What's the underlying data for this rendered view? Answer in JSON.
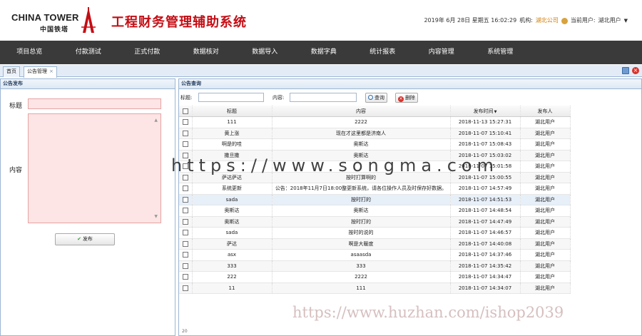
{
  "header": {
    "logo_en": "CHINA TOWER",
    "logo_cn": "中国铁塔",
    "app_title": "工程财务管理辅助系统",
    "datetime": "2019年 6月 28日 星期五 16:02:29",
    "org_label": "机构:",
    "org_value": "湖北公司",
    "user_label": "当前用户:",
    "user_value": "湖北用户",
    "brand_color": "#c40d14",
    "icons": [
      "china-tower-logo",
      "user-icon",
      "caret-down-icon"
    ]
  },
  "nav": {
    "items": [
      "项目总览",
      "付款测试",
      "正式付款",
      "数据核对",
      "数据导入",
      "数据字典",
      "统计报表",
      "内容管理",
      "系统管理"
    ]
  },
  "tabs": {
    "items": [
      {
        "label": "首页"
      },
      {
        "label": "公告管理"
      }
    ],
    "close_glyph": "×"
  },
  "left_panel": {
    "title": "公告发布",
    "title_label": "标题",
    "content_label": "内容",
    "publish_label": "发布"
  },
  "right_panel": {
    "title": "公告查询",
    "search": {
      "title_label": "标题:",
      "content_label": "内容:",
      "query_label": "查询",
      "delete_label": "删除"
    },
    "columns": [
      "标题",
      "内容",
      "发布时间",
      "发布人"
    ],
    "rows": [
      {
        "title": "111",
        "content": "2222",
        "time": "2018-11-13 15:27:31",
        "author": "湖北用户"
      },
      {
        "title": "黄上涨",
        "content": "现在才这里都是济南人",
        "time": "2018-11-07 15:10:41",
        "author": "湖北用户"
      },
      {
        "title": "啊是的哇",
        "content": "奥斯达",
        "time": "2018-11-07 15:08:43",
        "author": "湖北用户"
      },
      {
        "title": "撒旦撒",
        "content": "奥斯达",
        "time": "2018-11-07 15:03:02",
        "author": "湖北用户"
      },
      {
        "title": "",
        "content": "",
        "time": "2018-11-07 15:01:58",
        "author": "湖北用户"
      },
      {
        "title": "萨达萨达",
        "content": "按时打算啊的",
        "time": "2018-11-07 15:00:55",
        "author": "湖北用户"
      },
      {
        "title": "系统更新",
        "content": "公告：2018年11月7日18:00整更新系统，请各位操作人员及时保存好数据。",
        "time": "2018-11-07 14:57:49",
        "author": "湖北用户"
      },
      {
        "title": "sada",
        "content": "按时打的",
        "time": "2018-11-07 14:51:53",
        "author": "湖北用户"
      },
      {
        "title": "奥斯达",
        "content": "奥斯达",
        "time": "2018-11-07 14:48:54",
        "author": "湖北用户"
      },
      {
        "title": "奥斯达",
        "content": "按时打的",
        "time": "2018-11-07 14:47:49",
        "author": "湖北用户"
      },
      {
        "title": "sada",
        "content": "按时的说的",
        "time": "2018-11-07 14:46:57",
        "author": "湖北用户"
      },
      {
        "title": "萨达",
        "content": "啊是大暖度",
        "time": "2018-11-07 14:40:08",
        "author": "湖北用户"
      },
      {
        "title": "asx",
        "content": "asaasda",
        "time": "2018-11-07 14:37:46",
        "author": "湖北用户"
      },
      {
        "title": "333",
        "content": "333",
        "time": "2018-11-07 14:35:42",
        "author": "湖北用户"
      },
      {
        "title": "222",
        "content": "2222",
        "time": "2018-11-07 14:34:47",
        "author": "湖北用户"
      },
      {
        "title": "11",
        "content": "111",
        "time": "2018-11-07 14:34:07",
        "author": "湖北用户"
      }
    ],
    "pager": {
      "page_size": "20"
    }
  },
  "watermarks": {
    "center": "https://www.songma.com",
    "bottom": "https://www.huzhan.com/ishop2039"
  }
}
